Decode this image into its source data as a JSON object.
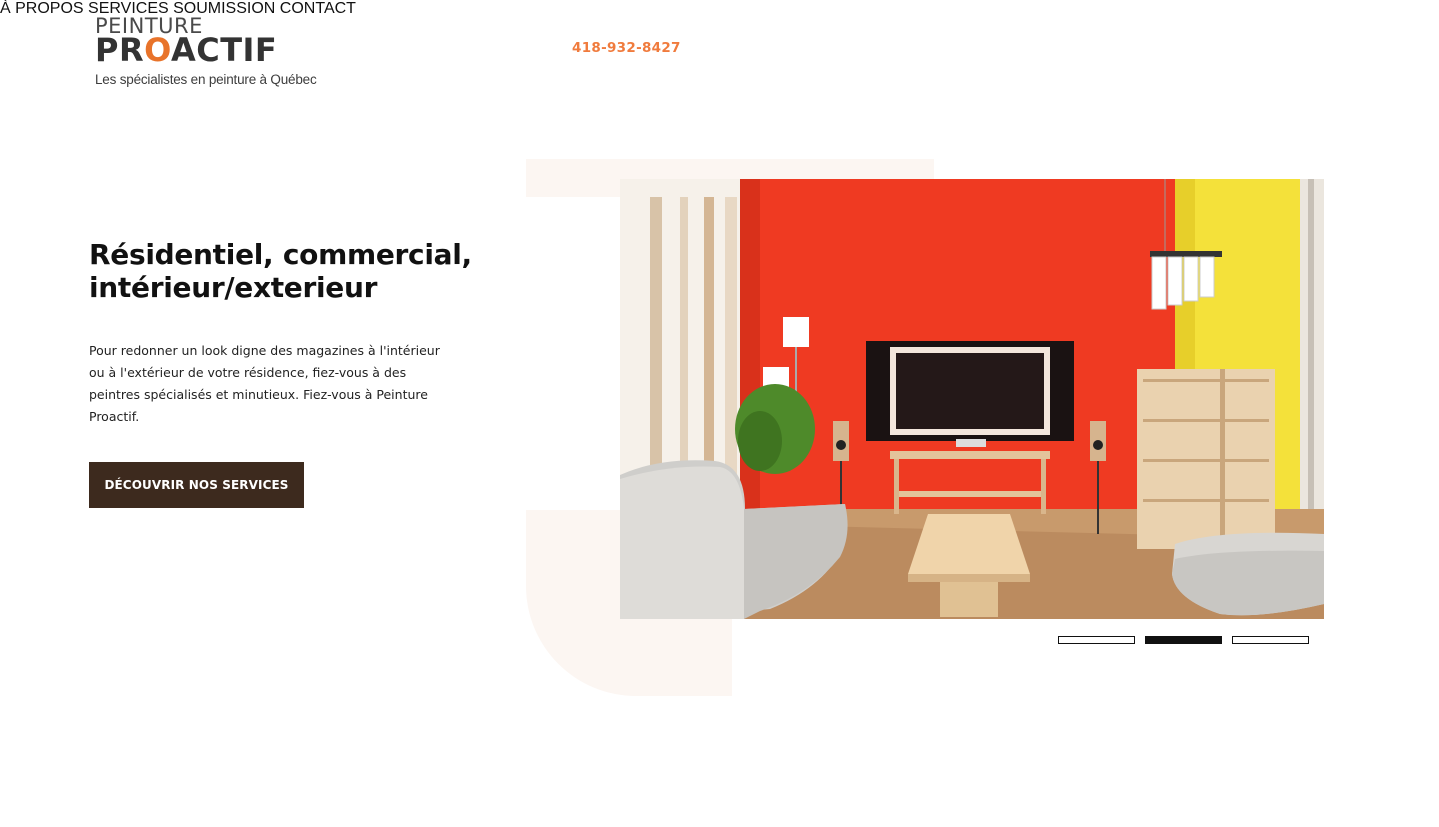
{
  "header": {
    "logo_top": "PEINTURE",
    "logo_main_left": "PR",
    "logo_main_o": "O",
    "logo_main_right": "ACTIF",
    "logo_tagline": "Les spécialistes en peinture à Québec",
    "phone": "418-932-8427",
    "nav": [
      "À PROPOS",
      "SERVICES",
      "SOUMISSION",
      "CONTACT"
    ]
  },
  "hero": {
    "title_line1": "Résidentiel, commercial,",
    "title_line2": "intérieur/exterieur",
    "text": "Pour redonner un look digne des magazines à l'intérieur ou à l'extérieur de votre résidence, fiez-vous à des peintres spécialisés et minutieux. Fiez-vous à Peinture Proactif.",
    "cta": "DÉCOUVRIR NOS SERVICES"
  },
  "slider": {
    "slide_count": 3,
    "active_index": 1
  },
  "colors": {
    "accent_orange": "#f07b3d",
    "button_brown": "#3d2a1e",
    "cream": "#fcf6f2"
  }
}
